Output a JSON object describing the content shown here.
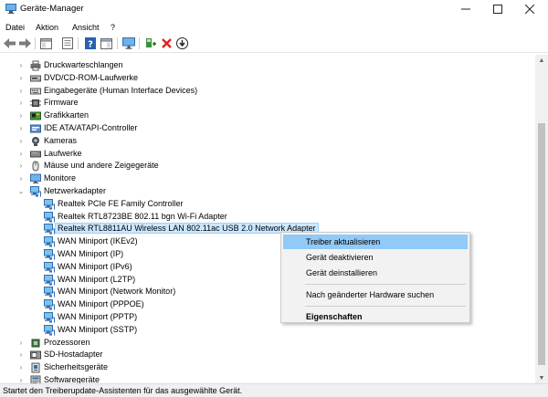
{
  "window": {
    "title": "Geräte-Manager"
  },
  "menu": {
    "items": [
      "Datei",
      "Aktion",
      "Ansicht",
      "?"
    ]
  },
  "tree": {
    "rows": [
      {
        "label": "Druckwarteschlangen",
        "expander": "collapsed",
        "icon": "printer-icon"
      },
      {
        "label": "DVD/CD-ROM-Laufwerke",
        "expander": "collapsed",
        "icon": "disc-drive-icon"
      },
      {
        "label": "Eingabegeräte (Human Interface Devices)",
        "expander": "collapsed",
        "icon": "hid-icon"
      },
      {
        "label": "Firmware",
        "expander": "collapsed",
        "icon": "firmware-icon"
      },
      {
        "label": "Grafikkarten",
        "expander": "collapsed",
        "icon": "graphics-card-icon"
      },
      {
        "label": "IDE ATA/ATAPI-Controller",
        "expander": "collapsed",
        "icon": "ide-controller-icon"
      },
      {
        "label": "Kameras",
        "expander": "collapsed",
        "icon": "camera-icon"
      },
      {
        "label": "Laufwerke",
        "expander": "collapsed",
        "icon": "disk-drive-icon"
      },
      {
        "label": "Mäuse und andere Zeigegeräte",
        "expander": "collapsed",
        "icon": "mouse-icon"
      },
      {
        "label": "Monitore",
        "expander": "collapsed",
        "icon": "monitor-icon"
      },
      {
        "label": "Netzwerkadapter",
        "expander": "expanded",
        "icon": "network-adapter-icon"
      },
      {
        "label": "Realtek PCIe FE Family Controller",
        "child": true,
        "icon": "network-adapter-icon"
      },
      {
        "label": "Realtek RTL8723BE 802.11 bgn Wi-Fi Adapter",
        "child": true,
        "icon": "network-adapter-icon"
      },
      {
        "label": "Realtek RTL8811AU Wireless LAN 802.11ac USB 2.0 Network Adapter",
        "child": true,
        "selected": true,
        "icon": "network-adapter-icon"
      },
      {
        "label": "WAN Miniport (IKEv2)",
        "child": true,
        "icon": "network-adapter-icon"
      },
      {
        "label": "WAN Miniport (IP)",
        "child": true,
        "icon": "network-adapter-icon"
      },
      {
        "label": "WAN Miniport (IPv6)",
        "child": true,
        "icon": "network-adapter-icon"
      },
      {
        "label": "WAN Miniport (L2TP)",
        "child": true,
        "icon": "network-adapter-icon"
      },
      {
        "label": "WAN Miniport (Network Monitor)",
        "child": true,
        "icon": "network-adapter-icon"
      },
      {
        "label": "WAN Miniport (PPPOE)",
        "child": true,
        "icon": "network-adapter-icon"
      },
      {
        "label": "WAN Miniport (PPTP)",
        "child": true,
        "icon": "network-adapter-icon"
      },
      {
        "label": "WAN Miniport (SSTP)",
        "child": true,
        "icon": "network-adapter-icon"
      },
      {
        "label": "Prozessoren",
        "expander": "collapsed",
        "icon": "processor-icon"
      },
      {
        "label": "SD-Hostadapter",
        "expander": "collapsed",
        "icon": "sd-host-icon"
      },
      {
        "label": "Sicherheitsgeräte",
        "expander": "collapsed",
        "icon": "security-device-icon"
      },
      {
        "label": "Softwaregeräte",
        "expander": "collapsed",
        "icon": "software-device-icon"
      }
    ]
  },
  "context_menu": {
    "items": [
      {
        "label": "Treiber aktualisieren",
        "highlighted": true
      },
      {
        "label": "Gerät deaktivieren"
      },
      {
        "label": "Gerät deinstallieren"
      },
      {
        "separator": true
      },
      {
        "label": "Nach geänderter Hardware suchen"
      },
      {
        "separator": true
      },
      {
        "label": "Eigenschaften",
        "bold": true
      }
    ]
  },
  "status": {
    "text": "Startet den Treiberupdate-Assistenten für das ausgewählte Gerät."
  },
  "colors": {
    "selection": "#cce8ff",
    "menu_highlight": "#91c9f7",
    "accent": "#1e6fcf",
    "danger": "#e02020"
  }
}
